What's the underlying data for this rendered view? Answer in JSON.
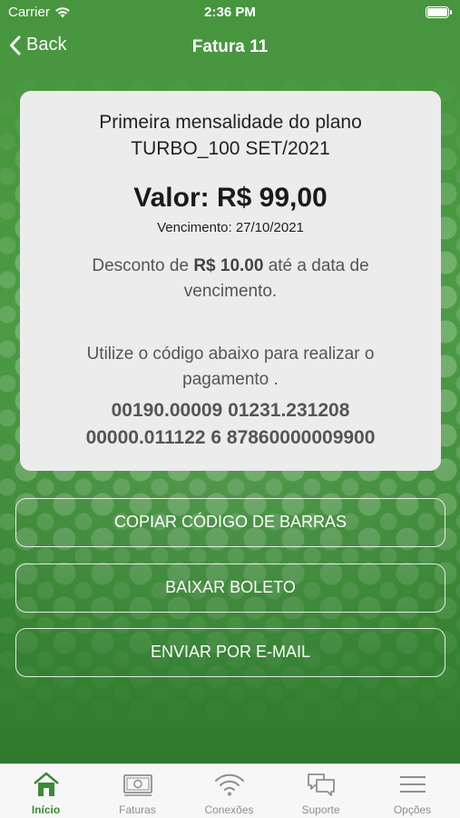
{
  "status_bar": {
    "carrier": "Carrier",
    "time": "2:36 PM"
  },
  "nav": {
    "back_label": "Back",
    "title": "Fatura 11"
  },
  "invoice": {
    "plan_line1": "Primeira mensalidade do plano",
    "plan_line2": "TURBO_100 SET/2021",
    "amount": "Valor: R$ 99,00",
    "due_date": "Vencimento: 27/10/2021",
    "discount_prefix": "Desconto de ",
    "discount_value": "R$ 10.00",
    "discount_suffix": " até a data de vencimento.",
    "instruction": "Utilize o código abaixo para realizar o pagamento .",
    "barcode_line1": "00190.00009 01231.231208",
    "barcode_line2": "00000.011122 6 87860000009900"
  },
  "actions": {
    "copy_barcode": "COPIAR CÓDIGO DE BARRAS",
    "download_slip": "BAIXAR BOLETO",
    "send_email": "ENVIAR POR E-MAIL"
  },
  "tabs": [
    {
      "label": "Início",
      "icon": "home-icon",
      "active": true
    },
    {
      "label": "Faturas",
      "icon": "bill-icon",
      "active": false
    },
    {
      "label": "Conexões",
      "icon": "wifi-icon",
      "active": false
    },
    {
      "label": "Suporte",
      "icon": "chat-icon",
      "active": false
    },
    {
      "label": "Opções",
      "icon": "menu-icon",
      "active": false
    }
  ],
  "colors": {
    "brand_green": "#3d8a38",
    "card_bg": "#ececec",
    "tab_inactive": "#8e8e93"
  }
}
